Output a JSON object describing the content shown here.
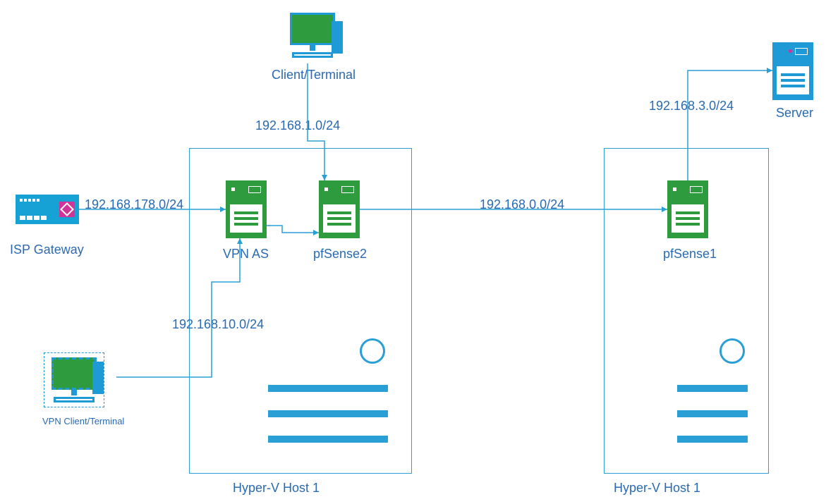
{
  "nodes": {
    "isp_gateway": {
      "label": "ISP Gateway"
    },
    "vpn_as": {
      "label": "VPN AS"
    },
    "pfsense2": {
      "label": "pfSense2"
    },
    "pfsense1": {
      "label": "pfSense1"
    },
    "server": {
      "label": "Server"
    },
    "client_terminal": {
      "label": "Client/Terminal"
    },
    "vpn_client_terminal": {
      "label": "VPN Client/Terminal"
    }
  },
  "hosts": {
    "host1": {
      "label": "Hyper-V Host 1"
    },
    "host2": {
      "label": "Hyper-V Host 1"
    }
  },
  "links": {
    "isp_to_vpnas": {
      "subnet": "192.168.178.0/24"
    },
    "client_to_pfsense2": {
      "subnet": "192.168.1.0/24"
    },
    "pfsense2_to_pfsense1": {
      "subnet": "192.168.0.0/24"
    },
    "pfsense1_to_server": {
      "subnet": "192.168.3.0/24"
    },
    "vpnclient_to_vpnas": {
      "subnet": "192.168.10.0/24"
    }
  },
  "colors": {
    "line": "#2a9fd6",
    "node_green": "#2e9b3f",
    "node_blue": "#1e9ad6",
    "text": "#2a6ab2",
    "accent_pink": "#d0339a"
  }
}
